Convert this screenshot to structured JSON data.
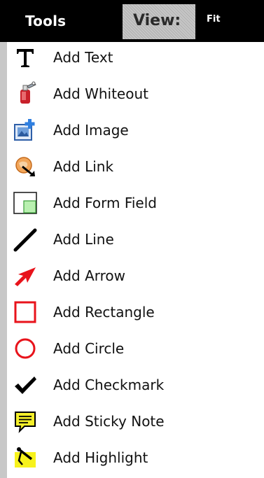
{
  "header": {
    "tools_label": "Tools",
    "view_label": "View:",
    "view_value": "Fit"
  },
  "tools": [
    {
      "label": "Add Text",
      "icon": "text-icon"
    },
    {
      "label": "Add Whiteout",
      "icon": "whiteout-icon"
    },
    {
      "label": "Add Image",
      "icon": "image-icon"
    },
    {
      "label": "Add Link",
      "icon": "link-icon"
    },
    {
      "label": "Add Form Field",
      "icon": "form-field-icon"
    },
    {
      "label": "Add Line",
      "icon": "line-icon"
    },
    {
      "label": "Add Arrow",
      "icon": "arrow-icon"
    },
    {
      "label": "Add Rectangle",
      "icon": "rectangle-icon"
    },
    {
      "label": "Add Circle",
      "icon": "circle-icon"
    },
    {
      "label": "Add Checkmark",
      "icon": "checkmark-icon"
    },
    {
      "label": "Add Sticky Note",
      "icon": "sticky-note-icon"
    },
    {
      "label": "Add Highlight",
      "icon": "highlight-icon"
    }
  ],
  "colors": {
    "header_bg": "#000000",
    "rail": "#c8c8c8",
    "shape_red": "#e8131b",
    "sticky_yellow": "#f4ef2a"
  }
}
